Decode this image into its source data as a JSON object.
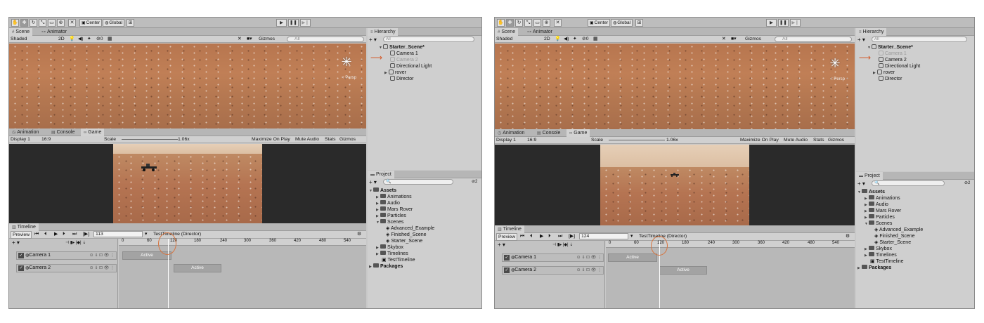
{
  "toolbar": {
    "center": "Center",
    "global": "Global"
  },
  "scene": {
    "tabs": [
      "Scene",
      "Animator"
    ],
    "shading": "Shaded",
    "mode_2d": "2D",
    "hidden_count": "0",
    "gizmos": "Gizmos",
    "search_all": "All",
    "persp": "< Persp"
  },
  "game": {
    "tabs": [
      "Animation",
      "Console",
      "Game"
    ],
    "display": "Display 1",
    "aspect": "16:9",
    "scale_label": "Scale",
    "scale_value": "1.06x",
    "buttons": [
      "Maximize On Play",
      "Mute Audio",
      "Stats",
      "Gizmos"
    ]
  },
  "hierarchy": {
    "title": "Hierarchy",
    "search": "All",
    "scene_name": "Starter_Scene*",
    "items": [
      "Camera 1",
      "Camera 2",
      "Directional Light",
      "rover",
      "Director"
    ]
  },
  "project": {
    "title": "Project",
    "badge": "2",
    "assets": "Assets",
    "folders": [
      "Animations",
      "Audio",
      "Mars Rover",
      "Particles",
      "Scenes"
    ],
    "scenes_children": [
      "Advanced_Example",
      "Finished_Scene",
      "Starter_Scene"
    ],
    "more": [
      "Skybox",
      "Timelines",
      "TestTimeline"
    ],
    "packages": "Packages"
  },
  "timeline": {
    "title": "Timeline",
    "preview": "Preview",
    "director_label": "TestTimeline (Director)",
    "tracks": [
      "Camera 1",
      "Camera 2"
    ],
    "clip_label": "Active",
    "ruler_left": [
      "0",
      "60",
      "120",
      "180",
      "240",
      "300",
      "360",
      "420",
      "480",
      "540"
    ],
    "ruler_right": [
      "0",
      "60",
      "120",
      "180",
      "240",
      "300",
      "360",
      "420",
      "480",
      "540"
    ]
  },
  "left": {
    "frame": "113"
  },
  "right": {
    "frame": "124"
  }
}
